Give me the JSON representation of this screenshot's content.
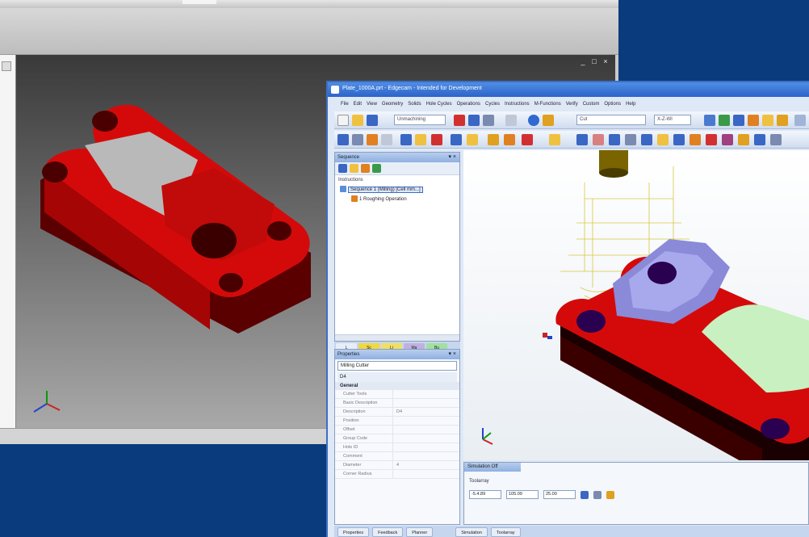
{
  "back_window": {
    "controls": [
      "_",
      "□",
      "×"
    ]
  },
  "front_window": {
    "title": "Plate_1000A.prt - Edgecam - Intended for Development",
    "menu": [
      "File",
      "Edit",
      "View",
      "Geometry",
      "Solids",
      "Hole Cycles",
      "Operations",
      "Cycles",
      "Instructions",
      "M-Functions",
      "Verify",
      "Custom",
      "Options",
      "Help"
    ],
    "combos": {
      "strategy": "Unmachining",
      "layer": "Cut",
      "view": "X-Z-Wl"
    },
    "sequence_panel": {
      "title": "Sequence",
      "pin": "▾ ×",
      "section_label": "Instructions",
      "items": [
        {
          "label": "Sequence 1 (Milling) [Cell mm...]",
          "selected": true
        },
        {
          "label": "1 Roughing Operation",
          "selected": false
        }
      ],
      "tabs": [
        "L",
        "Sc",
        "Li",
        "Ma",
        "Bu"
      ]
    },
    "properties_panel": {
      "title": "Properties",
      "pin": "▾ ×",
      "type_combo": "Milling Cutter",
      "tool_id": "D4",
      "group": "General",
      "rows": [
        {
          "key": "Cutter Tools",
          "value": ""
        },
        {
          "key": "Basic Description",
          "value": ""
        },
        {
          "key": "Description",
          "value": "D4"
        },
        {
          "key": "Position",
          "value": ""
        },
        {
          "key": "Offset",
          "value": ""
        },
        {
          "key": "Group Code",
          "value": ""
        },
        {
          "key": "Hole ID",
          "value": ""
        },
        {
          "key": "Comment",
          "value": ""
        },
        {
          "key": "Diameter",
          "value": "4"
        },
        {
          "key": "Corner Radius",
          "value": ""
        }
      ]
    },
    "simulation_panel": {
      "tab": "Simulation Off",
      "label": "Toolarray",
      "fields": [
        "-5.4.89",
        "105.09",
        "25.00"
      ]
    },
    "bottom_tabs": [
      "Properties",
      "Feedback",
      "Planner",
      "Simulation",
      "Toolarray"
    ]
  },
  "colors": {
    "part_red": "#d40a0a",
    "part_shadow": "#5a0000",
    "accent_blue": "#2d63c8",
    "desktop": "#0a3b7c"
  }
}
